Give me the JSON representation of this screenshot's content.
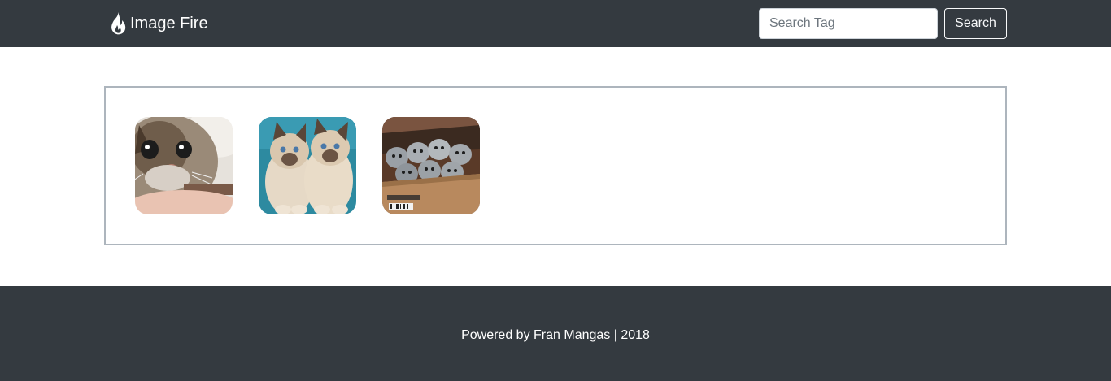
{
  "navbar": {
    "brand_name": "Image Fire",
    "brand_icon": "fire-icon",
    "search": {
      "placeholder": "Search Tag",
      "value": "",
      "button_label": "Search"
    }
  },
  "gallery": {
    "images": [
      {
        "subject": "kitten-closeup"
      },
      {
        "subject": "two-himalayan-kittens"
      },
      {
        "subject": "kittens-in-box"
      }
    ]
  },
  "footer": {
    "text": "Powered by Fran Mangas | 2018"
  },
  "colors": {
    "navbar_bg": "#343a40",
    "footer_bg": "#343a40",
    "gallery_border": "#adb5bd"
  }
}
